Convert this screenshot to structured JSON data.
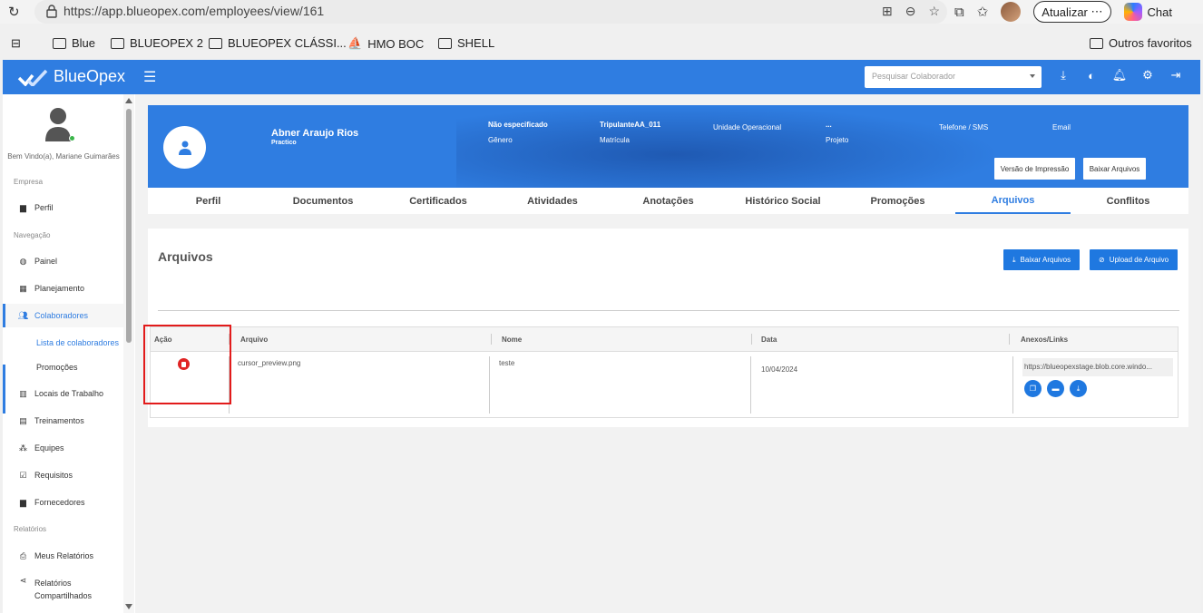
{
  "browser": {
    "url": "https://app.blueopex.com/employees/view/161",
    "update_label": "Atualizar",
    "chat_label": "Chat",
    "favorites": [
      "Blue",
      "BLUEOPEX 2",
      "BLUEOPEX CLÁSSI...",
      "HMO BOC",
      "SHELL"
    ],
    "other_favorites": "Outros favoritos"
  },
  "app": {
    "brand": "BlueOpex",
    "search_placeholder": "Pesquisar Colaborador"
  },
  "sidebar": {
    "welcome": "Bem Vindo(a), Mariane Guimarães",
    "sections": [
      "Empresa",
      "Navegação",
      "Relatórios"
    ],
    "items": [
      {
        "label": "Perfil",
        "icon": "briefcase-icon"
      },
      {
        "label": "Painel",
        "icon": "dashboard-icon"
      },
      {
        "label": "Planejamento",
        "icon": "calendar-icon"
      },
      {
        "label": "Colaboradores",
        "icon": "users-icon"
      },
      {
        "label": "Locais de Trabalho",
        "icon": "building-icon"
      },
      {
        "label": "Treinamentos",
        "icon": "training-icon"
      },
      {
        "label": "Equipes",
        "icon": "team-icon"
      },
      {
        "label": "Requisitos",
        "icon": "checkbox-icon"
      },
      {
        "label": "Fornecedores",
        "icon": "briefcase-icon"
      },
      {
        "label": "Meus Relatórios",
        "icon": "print-icon"
      },
      {
        "label": "Relatórios Compartilhados",
        "icon": "share-icon"
      }
    ],
    "sub_items": [
      "Lista de colaboradores",
      "Promoções"
    ]
  },
  "profile": {
    "name": "Abner Araujo Rios",
    "role": "Practico",
    "gender_value": "Não especificado",
    "gender_label": "Gênero",
    "registration_value": "TripulanteAA_011",
    "registration_label": "Matrícula",
    "unit_label": "Unidade Operacional",
    "project_value": "...",
    "project_label": "Projeto",
    "phone_label": "Telefone / SMS",
    "email_label": "Email",
    "print_button": "Versão de Impressão",
    "download_button": "Baixar Arquivos"
  },
  "tabs": [
    "Perfil",
    "Documentos",
    "Certificados",
    "Atividades",
    "Anotações",
    "Histórico Social",
    "Promoções",
    "Arquivos",
    "Conflitos"
  ],
  "files_card": {
    "title": "Arquivos",
    "download_all": "Baixar Arquivos",
    "upload": "Upload de Arquivo",
    "columns": [
      "Ação",
      "Arquivo",
      "Nome",
      "Data",
      "Anexos/Links"
    ],
    "rows": [
      {
        "arquivo": "cursor_preview.png",
        "nome": "teste",
        "data": "10/04/2024",
        "link": "https://blueopexstage.blob.core.windo..."
      }
    ]
  },
  "colors": {
    "primary": "#2f7de1",
    "highlight": "#e21b1b",
    "danger": "#e02424"
  }
}
